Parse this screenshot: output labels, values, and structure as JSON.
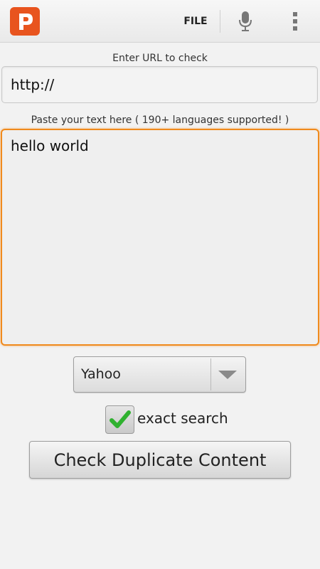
{
  "actionbar": {
    "app_icon": "p-logo-icon",
    "file_label": "FILE",
    "mic_icon": "microphone-icon",
    "overflow_icon": "overflow-menu-icon"
  },
  "url": {
    "label": "Enter URL to check",
    "value": "http://"
  },
  "text": {
    "label": "Paste your text here ( 190+ languages supported! )",
    "value": "hello world"
  },
  "engine": {
    "selected": "Yahoo"
  },
  "exact_search": {
    "checked": true,
    "label": "exact search"
  },
  "check_button": {
    "label": "Check Duplicate Content"
  },
  "colors": {
    "accent": "#f08a1d",
    "app_icon_bg": "#e8541e",
    "check_green": "#2fb12f"
  }
}
